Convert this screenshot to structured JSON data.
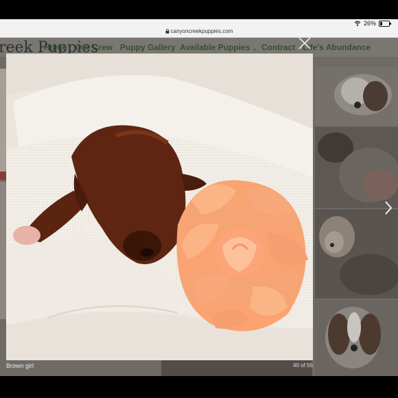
{
  "status_bar": {
    "battery_label": "26%",
    "battery_level": 0.26,
    "icons": [
      "wifi-icon",
      "battery-icon"
    ]
  },
  "browser": {
    "url": "canyoncreekpuppies.com",
    "icon": "lock-icon"
  },
  "site": {
    "logo_text": "reek Puppies",
    "nav": [
      {
        "label": "Home"
      },
      {
        "label": "Our Crew"
      },
      {
        "label": "Puppy Gallery"
      },
      {
        "label": "Available Puppies"
      },
      {
        "label": "Contract"
      },
      {
        "label": "Life's Abundance"
      }
    ],
    "nav_colors": {
      "link": "#33502b",
      "bar": "#7a7773"
    }
  },
  "lightbox": {
    "caption": "Brown girl",
    "counter": "40 of 56",
    "close_icon": "close-icon",
    "next_icon": "chevron-right-icon"
  }
}
